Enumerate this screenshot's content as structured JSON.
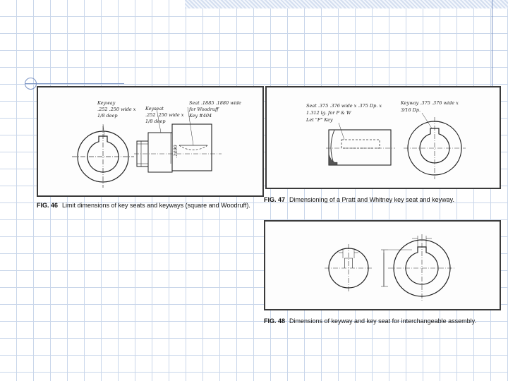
{
  "fig46": {
    "number": "FIG. 46",
    "caption": "Limit dimensions of key seats and keyways (square and Woodruff).",
    "notes": {
      "keyway": [
        "Keyway",
        ".252 .250 wide x",
        "1/8 deep"
      ],
      "keyseat": [
        "Keyseat",
        ".252 .250 wide x",
        "1/8 deep"
      ],
      "seat": [
        "Seat .1885 .1880 wide",
        "for Woodruff",
        "Key #404"
      ],
      "dim": ".1490"
    }
  },
  "fig47": {
    "number": "FIG. 47",
    "caption": "Dimensioning of a Pratt and Whitney key seat and keyway.",
    "notes": {
      "seat": [
        "Seat .375 .376 wide x .375 Dp. x",
        "1.312 lg. for P & W",
        "Let \"F\" Key"
      ],
      "keyway": [
        "Keyway .375 .376 wide x",
        "3/16 Dp."
      ]
    }
  },
  "fig48": {
    "number": "FIG. 48",
    "caption": "Dimensions of keyway and key seat for interchangeable assembly."
  }
}
